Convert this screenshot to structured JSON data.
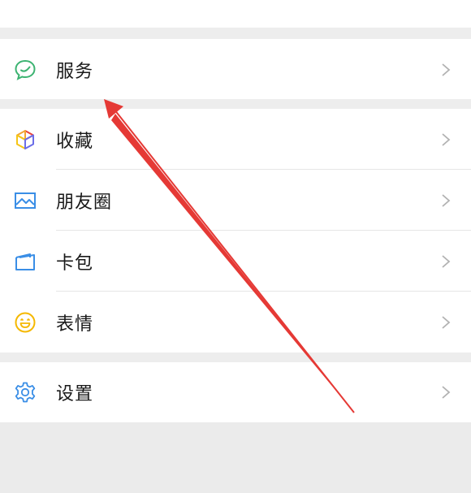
{
  "menu": {
    "service": {
      "label": "服务",
      "icon": "chat-bubble-icon",
      "color": "#3cb371"
    },
    "favorites": {
      "label": "收藏",
      "icon": "cube-icon"
    },
    "moments": {
      "label": "朋友圈",
      "icon": "image-icon",
      "color": "#3a8ee6"
    },
    "cards": {
      "label": "卡包",
      "icon": "card-wallet-icon",
      "color": "#3a8ee6"
    },
    "stickers": {
      "label": "表情",
      "icon": "smiley-icon",
      "color": "#f5b800"
    },
    "settings": {
      "label": "设置",
      "icon": "gear-icon",
      "color": "#3a8ee6"
    }
  },
  "annotation": {
    "arrow_color": "#e53935"
  }
}
